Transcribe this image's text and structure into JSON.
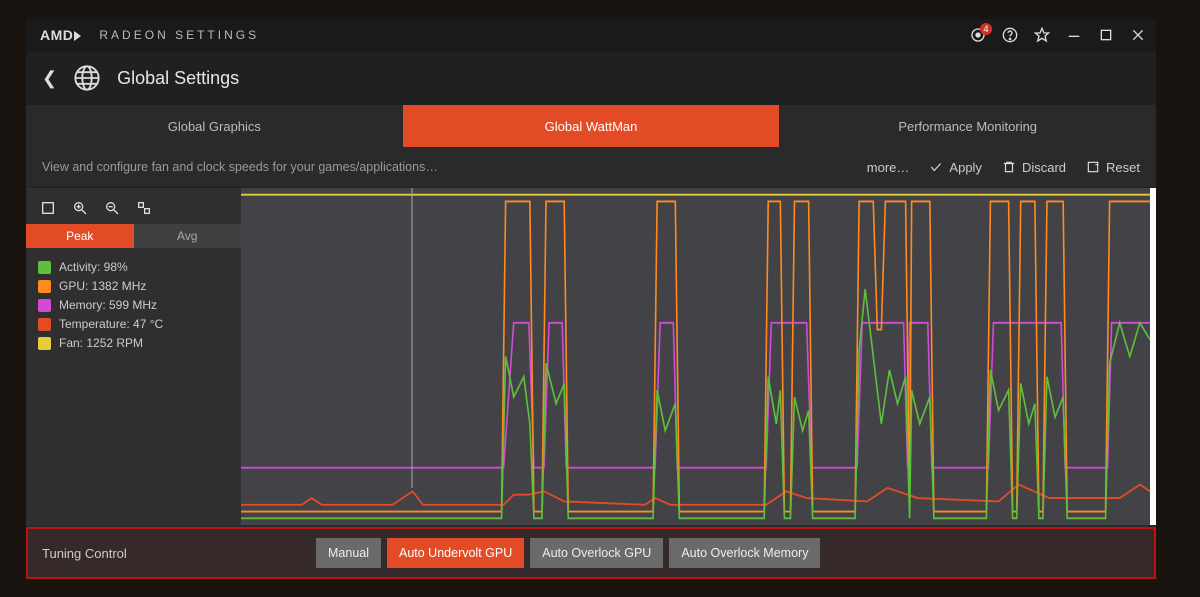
{
  "titlebar": {
    "brand": "AMD",
    "app_name": "RADEON SETTINGS",
    "notification_count": "4"
  },
  "header": {
    "page_title": "Global Settings"
  },
  "tabs": {
    "graphics": "Global Graphics",
    "wattman": "Global WattMan",
    "perfmon": "Performance Monitoring"
  },
  "description": "View and configure fan and clock speeds for your games/applications…",
  "actions": {
    "more": "more…",
    "apply": "Apply",
    "discard": "Discard",
    "reset": "Reset"
  },
  "peak_avg": {
    "peak": "Peak",
    "avg": "Avg"
  },
  "legend": {
    "activity": {
      "label": "Activity: 98%",
      "color": "#5fbf3d"
    },
    "gpu": {
      "label": "GPU: 1382 MHz",
      "color": "#ff8b1f"
    },
    "memory": {
      "label": "Memory: 599 MHz",
      "color": "#d14bd6"
    },
    "temperature": {
      "label": "Temperature: 47 °C",
      "color": "#e34b27"
    },
    "fan": {
      "label": "Fan: 1252 RPM",
      "color": "#e6cc3b"
    }
  },
  "tuning": {
    "label": "Tuning Control",
    "manual": "Manual",
    "undervolt": "Auto Undervolt GPU",
    "overclock_gpu": "Auto Overlock GPU",
    "overclock_mem": "Auto Overlock Memory"
  },
  "chart_data": {
    "type": "line",
    "xlabel": "",
    "ylabel": "",
    "title": "",
    "x_range": [
      0,
      900
    ],
    "y_range": [
      0,
      100
    ],
    "series": [
      {
        "name": "Fan",
        "color": "#e6cc3b",
        "values": [
          [
            0,
            98
          ],
          [
            900,
            98
          ]
        ]
      },
      {
        "name": "Temperature",
        "color": "#e34b27",
        "values": [
          [
            0,
            6
          ],
          [
            60,
            6
          ],
          [
            70,
            8
          ],
          [
            80,
            6
          ],
          [
            150,
            6
          ],
          [
            170,
            10
          ],
          [
            180,
            6
          ],
          [
            260,
            6
          ],
          [
            270,
            9
          ],
          [
            285,
            9
          ],
          [
            300,
            10
          ],
          [
            320,
            7
          ],
          [
            400,
            6
          ],
          [
            410,
            8
          ],
          [
            425,
            6
          ],
          [
            520,
            6
          ],
          [
            540,
            10
          ],
          [
            560,
            8
          ],
          [
            620,
            7
          ],
          [
            640,
            11
          ],
          [
            670,
            8
          ],
          [
            750,
            7
          ],
          [
            770,
            12
          ],
          [
            800,
            8
          ],
          [
            870,
            8
          ],
          [
            890,
            12
          ],
          [
            900,
            10
          ]
        ]
      },
      {
        "name": "Memory",
        "color": "#d14bd6",
        "values": [
          [
            0,
            17
          ],
          [
            260,
            17
          ],
          [
            270,
            60
          ],
          [
            285,
            60
          ],
          [
            290,
            17
          ],
          [
            300,
            17
          ],
          [
            305,
            60
          ],
          [
            318,
            60
          ],
          [
            322,
            17
          ],
          [
            410,
            17
          ],
          [
            415,
            60
          ],
          [
            428,
            60
          ],
          [
            432,
            17
          ],
          [
            520,
            17
          ],
          [
            525,
            60
          ],
          [
            560,
            60
          ],
          [
            565,
            17
          ],
          [
            610,
            17
          ],
          [
            615,
            60
          ],
          [
            656,
            60
          ],
          [
            660,
            17
          ],
          [
            662,
            60
          ],
          [
            680,
            60
          ],
          [
            684,
            17
          ],
          [
            740,
            17
          ],
          [
            745,
            60
          ],
          [
            812,
            60
          ],
          [
            816,
            17
          ],
          [
            858,
            17
          ],
          [
            862,
            60
          ],
          [
            900,
            60
          ]
        ]
      },
      {
        "name": "GPU",
        "color": "#ff8b1f",
        "values": [
          [
            0,
            4
          ],
          [
            258,
            4
          ],
          [
            262,
            96
          ],
          [
            286,
            96
          ],
          [
            290,
            4
          ],
          [
            298,
            4
          ],
          [
            302,
            96
          ],
          [
            320,
            96
          ],
          [
            324,
            4
          ],
          [
            408,
            4
          ],
          [
            412,
            96
          ],
          [
            430,
            96
          ],
          [
            434,
            4
          ],
          [
            518,
            4
          ],
          [
            522,
            96
          ],
          [
            534,
            96
          ],
          [
            538,
            4
          ],
          [
            544,
            4
          ],
          [
            548,
            96
          ],
          [
            562,
            96
          ],
          [
            566,
            4
          ],
          [
            608,
            4
          ],
          [
            612,
            96
          ],
          [
            626,
            96
          ],
          [
            630,
            58
          ],
          [
            634,
            58
          ],
          [
            638,
            96
          ],
          [
            658,
            96
          ],
          [
            662,
            4
          ],
          [
            664,
            96
          ],
          [
            682,
            96
          ],
          [
            686,
            4
          ],
          [
            738,
            4
          ],
          [
            742,
            96
          ],
          [
            760,
            96
          ],
          [
            764,
            4
          ],
          [
            768,
            4
          ],
          [
            772,
            96
          ],
          [
            786,
            96
          ],
          [
            790,
            4
          ],
          [
            794,
            4
          ],
          [
            798,
            96
          ],
          [
            814,
            96
          ],
          [
            818,
            4
          ],
          [
            856,
            4
          ],
          [
            860,
            96
          ],
          [
            900,
            96
          ]
        ]
      },
      {
        "name": "Activity",
        "color": "#5fbf3d",
        "values": [
          [
            0,
            2
          ],
          [
            258,
            2
          ],
          [
            262,
            50
          ],
          [
            270,
            38
          ],
          [
            280,
            44
          ],
          [
            286,
            30
          ],
          [
            290,
            2
          ],
          [
            298,
            2
          ],
          [
            302,
            48
          ],
          [
            312,
            36
          ],
          [
            320,
            42
          ],
          [
            324,
            2
          ],
          [
            408,
            2
          ],
          [
            412,
            40
          ],
          [
            420,
            28
          ],
          [
            430,
            36
          ],
          [
            434,
            2
          ],
          [
            518,
            2
          ],
          [
            522,
            44
          ],
          [
            530,
            30
          ],
          [
            534,
            40
          ],
          [
            538,
            2
          ],
          [
            544,
            2
          ],
          [
            548,
            38
          ],
          [
            556,
            28
          ],
          [
            562,
            34
          ],
          [
            566,
            2
          ],
          [
            608,
            2
          ],
          [
            612,
            52
          ],
          [
            618,
            70
          ],
          [
            626,
            50
          ],
          [
            634,
            30
          ],
          [
            642,
            46
          ],
          [
            650,
            36
          ],
          [
            658,
            44
          ],
          [
            662,
            2
          ],
          [
            664,
            40
          ],
          [
            672,
            30
          ],
          [
            682,
            38
          ],
          [
            686,
            2
          ],
          [
            738,
            2
          ],
          [
            742,
            46
          ],
          [
            750,
            34
          ],
          [
            760,
            40
          ],
          [
            764,
            2
          ],
          [
            768,
            2
          ],
          [
            772,
            42
          ],
          [
            780,
            30
          ],
          [
            786,
            36
          ],
          [
            790,
            2
          ],
          [
            794,
            2
          ],
          [
            798,
            44
          ],
          [
            806,
            32
          ],
          [
            814,
            38
          ],
          [
            818,
            2
          ],
          [
            856,
            2
          ],
          [
            860,
            48
          ],
          [
            870,
            60
          ],
          [
            880,
            50
          ],
          [
            890,
            60
          ],
          [
            900,
            55
          ]
        ]
      }
    ]
  },
  "colors": {
    "accent": "#e34b27",
    "bg_dark": "#1a1a1a",
    "bg_mid": "#2a2a2a"
  }
}
